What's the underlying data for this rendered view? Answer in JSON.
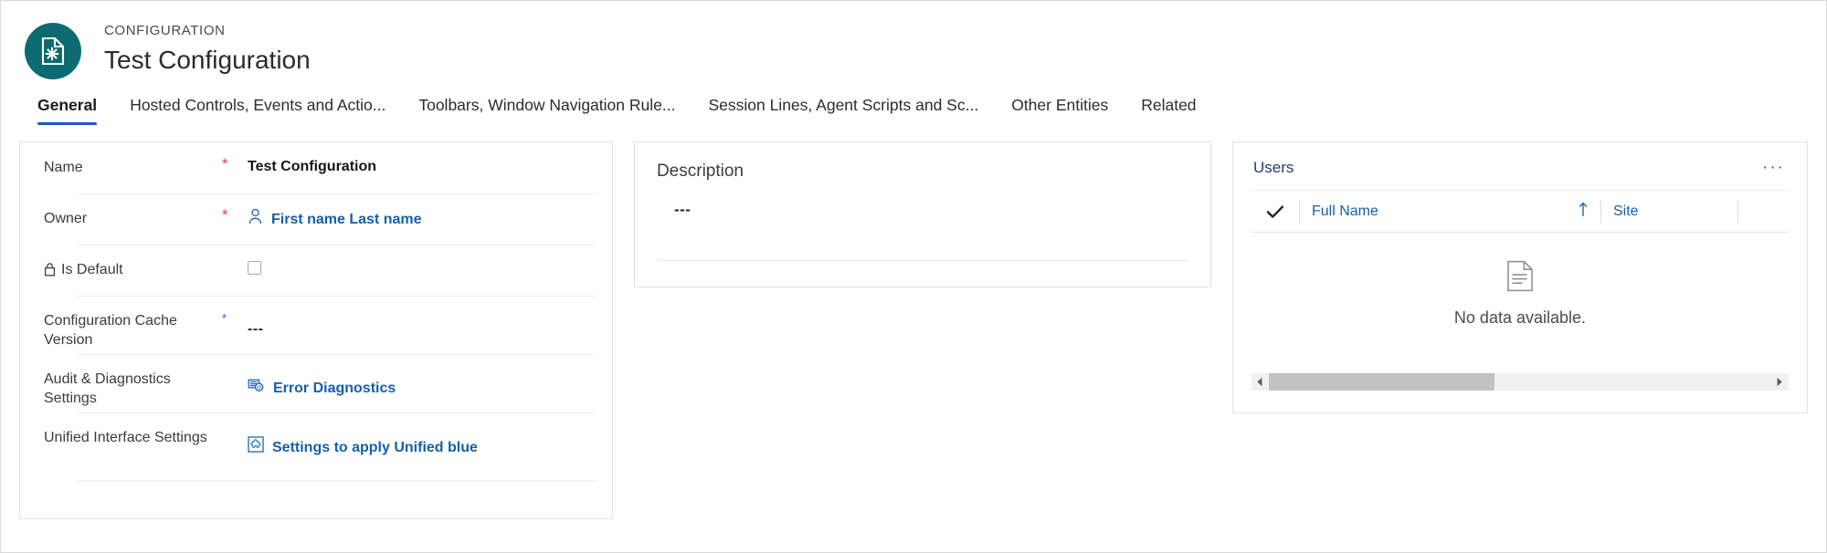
{
  "header": {
    "entity_type": "CONFIGURATION",
    "title": "Test Configuration",
    "avatar_icon": "configuration-document-gear-icon",
    "avatar_color": "#0c6b71"
  },
  "tabs": [
    {
      "label": "General",
      "active": true
    },
    {
      "label": "Hosted Controls, Events and Actio...",
      "active": false
    },
    {
      "label": "Toolbars, Window Navigation Rule...",
      "active": false
    },
    {
      "label": "Session Lines, Agent Scripts and Sc...",
      "active": false
    },
    {
      "label": "Other Entities",
      "active": false
    },
    {
      "label": "Related",
      "active": false
    }
  ],
  "accent": {
    "tab_underline": "#185abd",
    "link": "#1560ab",
    "required_asterisk": "#e0434c",
    "recommended_asterisk": "#4a4ae0"
  },
  "form": {
    "fields": [
      {
        "label": "Name",
        "requirement": "required",
        "asterisk": "*",
        "value": "Test Configuration",
        "value_kind": "text",
        "locked": false
      },
      {
        "label": "Owner",
        "requirement": "required",
        "asterisk": "*",
        "value": "First name Last name",
        "value_kind": "link",
        "icon": "person-icon",
        "locked": false
      },
      {
        "label": "Is Default",
        "requirement": "none",
        "asterisk": "",
        "value": "",
        "value_kind": "checkbox",
        "checked": false,
        "locked": true,
        "lock_icon": "lock-icon"
      },
      {
        "label": "Configuration Cache Version",
        "requirement": "recommended",
        "asterisk": "*",
        "value": "---",
        "value_kind": "dashes",
        "locked": false
      },
      {
        "label": "Audit & Diagnostics Settings",
        "requirement": "none",
        "asterisk": "",
        "value": "Error Diagnostics",
        "value_kind": "link",
        "icon": "diagnostics-list-icon",
        "locked": false
      },
      {
        "label": "Unified Interface Settings",
        "requirement": "none",
        "asterisk": "",
        "value": "Settings to apply Unified blue",
        "value_kind": "link",
        "icon": "puzzle-piece-icon",
        "locked": false
      }
    ]
  },
  "description": {
    "title": "Description",
    "value": "---"
  },
  "users": {
    "title": "Users",
    "overflow_label": "···",
    "columns": [
      {
        "label": "Full Name",
        "sort": "ascending",
        "sort_icon": "arrow-up-icon"
      },
      {
        "label": "Site",
        "sort": "none",
        "sort_icon": ""
      }
    ],
    "select_all_icon": "checkmark-icon",
    "empty_state": {
      "icon": "empty-document-icon",
      "text": "No data available."
    },
    "scrollbar": {
      "left_arrow_icon": "caret-left-icon",
      "right_arrow_icon": "caret-right-icon",
      "thumb_percent": 45
    }
  }
}
